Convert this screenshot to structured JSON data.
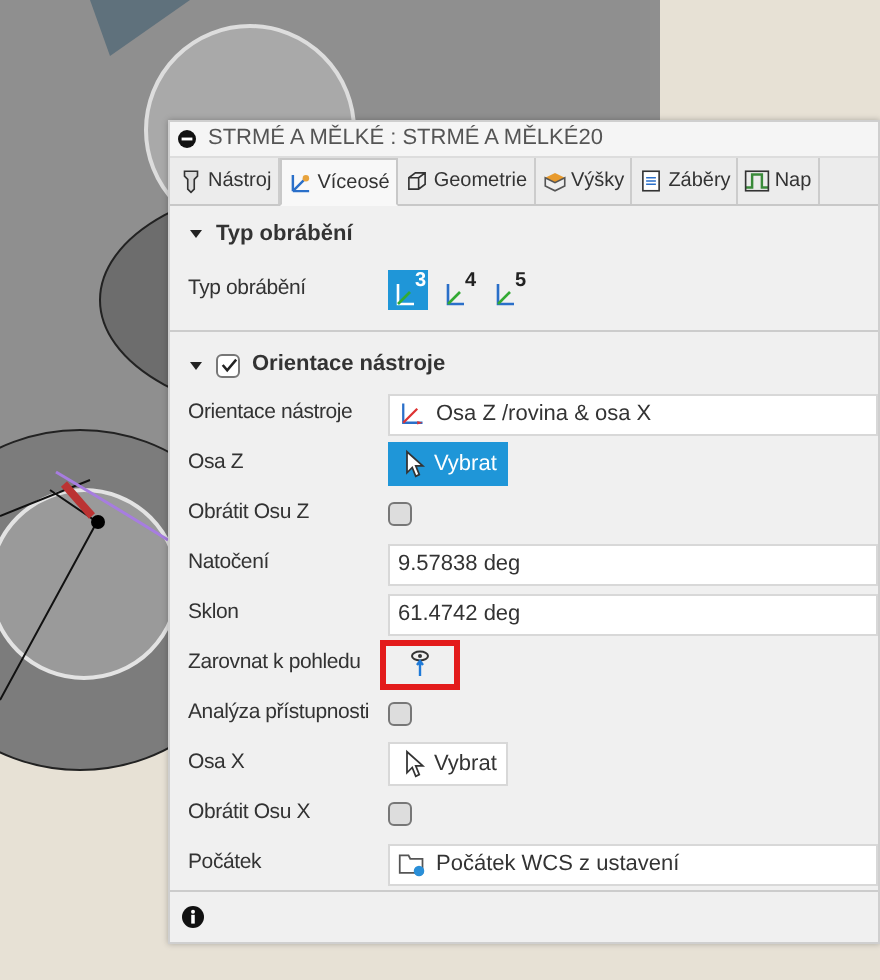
{
  "window": {
    "title": "STRMÉ A MĚLKÉ : STRMÉ A MĚLKÉ20"
  },
  "tabs": [
    {
      "label": "Nástroj",
      "selected": false,
      "kind": "tool"
    },
    {
      "label": "Víceosé",
      "selected": true,
      "kind": "multiaxis"
    },
    {
      "label": "Geometrie",
      "selected": false,
      "kind": "geometry"
    },
    {
      "label": "Výšky",
      "selected": false,
      "kind": "heights"
    },
    {
      "label": "Záběry",
      "selected": false,
      "kind": "passes"
    },
    {
      "label": "Nap",
      "selected": false,
      "kind": "linking"
    }
  ],
  "sections": [
    {
      "title": "Typ obrábění",
      "expanded": true,
      "rows": [
        {
          "kind": "axis-choice",
          "label": "Typ obrábění",
          "options": [
            {
              "label": "3",
              "selected": true
            },
            {
              "label": "4",
              "selected": false
            },
            {
              "label": "5",
              "selected": false
            }
          ]
        }
      ]
    },
    {
      "title": "Orientace nástroje",
      "expanded": true,
      "checked": true,
      "rows": [
        {
          "kind": "dropdown",
          "label": "Orientace nástroje",
          "value": "Osa Z /rovina & osa X"
        },
        {
          "kind": "select-button",
          "label": "Osa Z",
          "value": "Vybrat",
          "active": true
        },
        {
          "kind": "checkbox",
          "label": "Obrátit Osu Z",
          "checked": false
        },
        {
          "kind": "text",
          "label": "Natočení",
          "value": "9.57838 deg"
        },
        {
          "kind": "text",
          "label": "Sklon",
          "value": "61.4742 deg"
        },
        {
          "kind": "view-button",
          "label": "Zarovnat k pohledu",
          "highlighted": true
        },
        {
          "kind": "checkbox",
          "label": "Analýza přístupnosti",
          "checked": false
        },
        {
          "kind": "select-button",
          "label": "Osa X",
          "value": "Vybrat",
          "active": false
        },
        {
          "kind": "checkbox",
          "label": "Obrátit Osu X",
          "checked": false
        },
        {
          "kind": "dropdown",
          "label": "Počátek",
          "value": "Počátek WCS z ustavení"
        }
      ]
    }
  ]
}
